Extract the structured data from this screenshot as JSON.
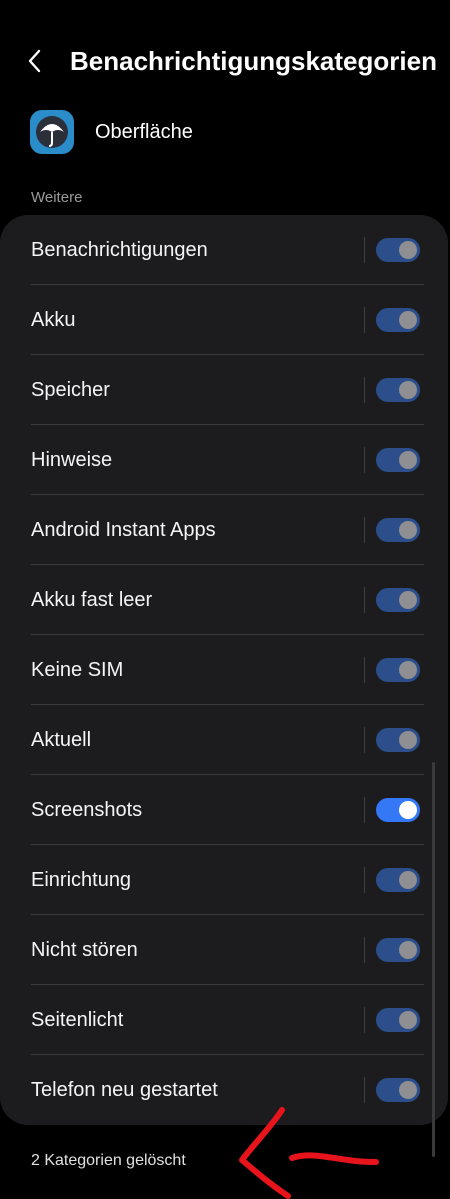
{
  "header": {
    "title": "Benachrichtigungskategorien",
    "back_icon": "chevron-left-icon"
  },
  "app": {
    "name": "Oberfläche",
    "icon": "umbrella-app-icon"
  },
  "section": {
    "label": "Weitere"
  },
  "categories": [
    {
      "label": "Benachrichtigungen",
      "enabled": true,
      "highlighted": false
    },
    {
      "label": "Akku",
      "enabled": true,
      "highlighted": false
    },
    {
      "label": "Speicher",
      "enabled": true,
      "highlighted": false
    },
    {
      "label": "Hinweise",
      "enabled": true,
      "highlighted": false
    },
    {
      "label": "Android Instant Apps",
      "enabled": true,
      "highlighted": false
    },
    {
      "label": "Akku fast leer",
      "enabled": true,
      "highlighted": false
    },
    {
      "label": "Keine SIM",
      "enabled": true,
      "highlighted": false
    },
    {
      "label": "Aktuell",
      "enabled": true,
      "highlighted": false
    },
    {
      "label": "Screenshots",
      "enabled": true,
      "highlighted": true
    },
    {
      "label": "Einrichtung",
      "enabled": true,
      "highlighted": false
    },
    {
      "label": "Nicht stören",
      "enabled": true,
      "highlighted": false
    },
    {
      "label": "Seitenlicht",
      "enabled": true,
      "highlighted": false
    },
    {
      "label": "Telefon neu gestartet",
      "enabled": true,
      "highlighted": false
    }
  ],
  "footer": {
    "text": "2 Kategorien gelöscht"
  },
  "colors": {
    "background": "#000000",
    "card": "#1c1c1e",
    "toggle_dim": "#2c4e8a",
    "toggle_active": "#3478f6",
    "annotation": "#e8141c"
  }
}
